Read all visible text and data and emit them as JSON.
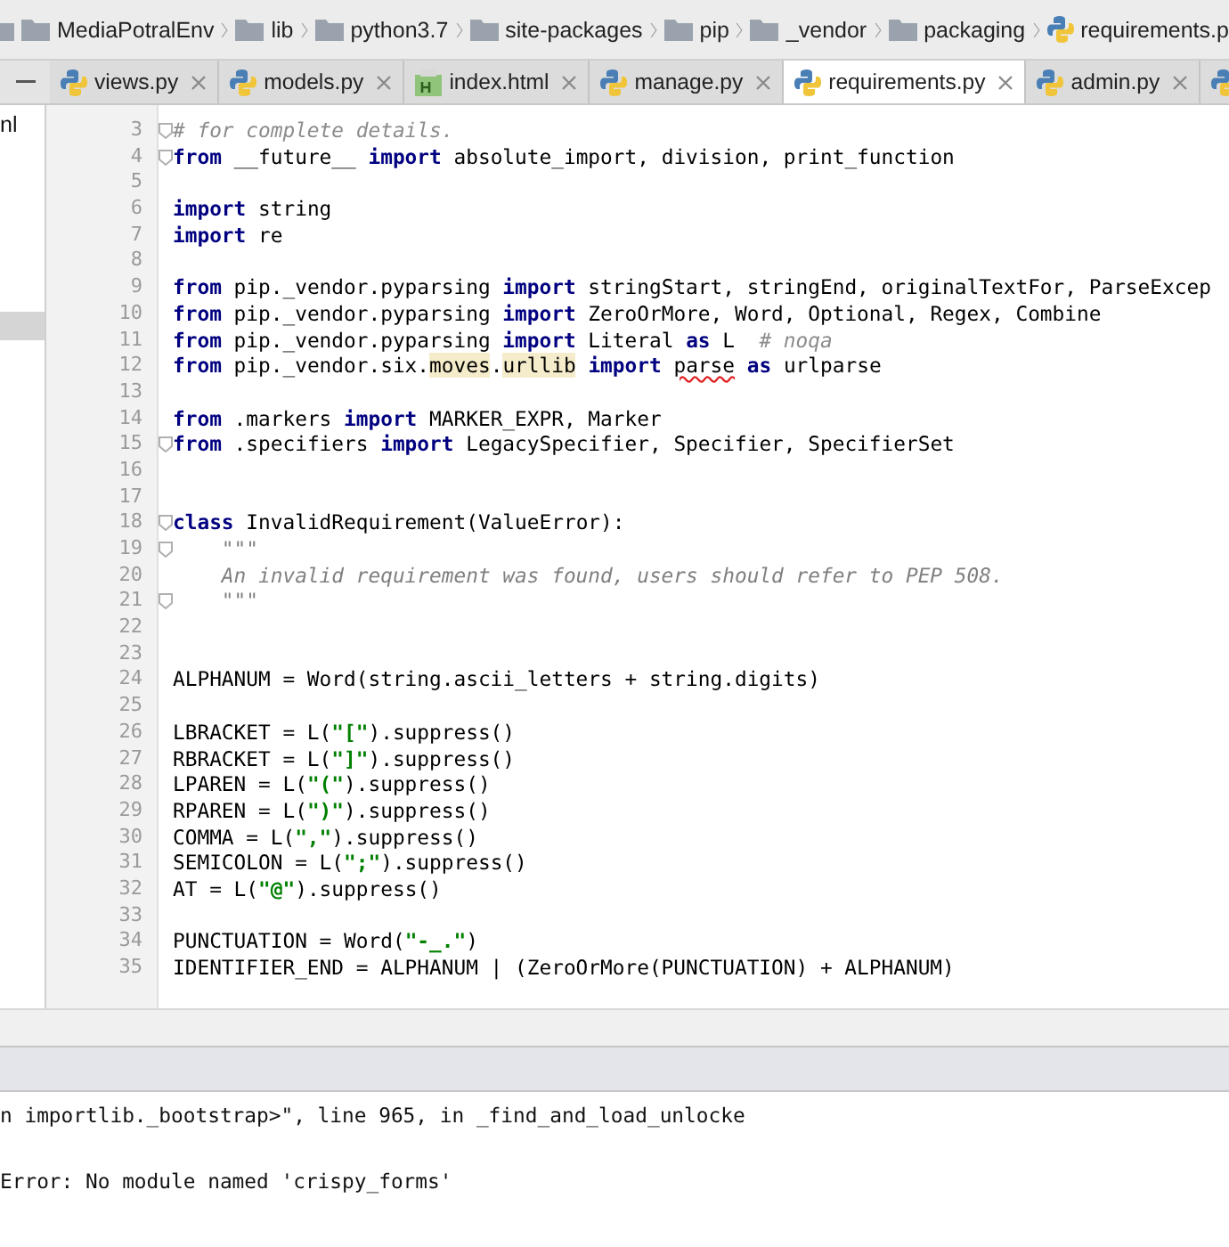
{
  "breadcrumbs": [
    {
      "label": "MediaPotralEnv",
      "kind": "folder"
    },
    {
      "label": "lib",
      "kind": "folder"
    },
    {
      "label": "python3.7",
      "kind": "folder"
    },
    {
      "label": "site-packages",
      "kind": "folder"
    },
    {
      "label": "pip",
      "kind": "folder"
    },
    {
      "label": "_vendor",
      "kind": "folder"
    },
    {
      "label": "packaging",
      "kind": "folder"
    },
    {
      "label": "requirements.p",
      "kind": "python"
    }
  ],
  "sidebar": {
    "items": [
      {
        "label": "nl",
        "selected": false
      }
    ]
  },
  "tabs": [
    {
      "label": "views.py",
      "kind": "python",
      "selected": false
    },
    {
      "label": "models.py",
      "kind": "python",
      "selected": false
    },
    {
      "label": "index.html",
      "kind": "html",
      "selected": false
    },
    {
      "label": "manage.py",
      "kind": "python",
      "selected": false
    },
    {
      "label": "requirements.py",
      "kind": "python",
      "selected": true
    },
    {
      "label": "admin.py",
      "kind": "python",
      "selected": false
    }
  ],
  "editor": {
    "lines": [
      {
        "number": "3",
        "fold": true,
        "tokens": [
          {
            "kind": "comment",
            "text": "# for complete details."
          }
        ]
      },
      {
        "number": "4",
        "fold": true,
        "tokens": [
          {
            "kind": "keyword",
            "text": "from"
          },
          {
            "kind": "plain",
            "text": " __future__ "
          },
          {
            "kind": "keyword",
            "text": "import"
          },
          {
            "kind": "plain",
            "text": " absolute_import, division, print_function"
          }
        ]
      },
      {
        "number": "5",
        "fold": false
      },
      {
        "number": "6",
        "fold": false,
        "tokens": [
          {
            "kind": "keyword",
            "text": "import"
          },
          {
            "kind": "plain",
            "text": " string"
          }
        ]
      },
      {
        "number": "7",
        "fold": false,
        "tokens": [
          {
            "kind": "keyword",
            "text": "import"
          },
          {
            "kind": "plain",
            "text": " re"
          }
        ]
      },
      {
        "number": "8",
        "fold": false
      },
      {
        "number": "9",
        "fold": false,
        "tokens": [
          {
            "kind": "keyword",
            "text": "from"
          },
          {
            "kind": "plain",
            "text": " pip._vendor.pyparsing "
          },
          {
            "kind": "keyword",
            "text": "import"
          },
          {
            "kind": "plain",
            "text": " stringStart, stringEnd, originalTextFor, ParseExcep"
          }
        ]
      },
      {
        "number": "10",
        "fold": false,
        "tokens": [
          {
            "kind": "keyword",
            "text": "from"
          },
          {
            "kind": "plain",
            "text": " pip._vendor.pyparsing "
          },
          {
            "kind": "keyword",
            "text": "import"
          },
          {
            "kind": "plain",
            "text": " ZeroOrMore, Word, Optional, Regex, Combine"
          }
        ]
      },
      {
        "number": "11",
        "fold": false,
        "tokens": [
          {
            "kind": "keyword",
            "text": "from"
          },
          {
            "kind": "plain",
            "text": " pip._vendor.pyparsing "
          },
          {
            "kind": "keyword",
            "text": "import"
          },
          {
            "kind": "plain",
            "text": " Literal "
          },
          {
            "kind": "keyword",
            "text": "as"
          },
          {
            "kind": "plain",
            "text": " L  "
          },
          {
            "kind": "comment",
            "text": "# noqa"
          }
        ]
      },
      {
        "number": "12",
        "fold": false,
        "tokens": [
          {
            "kind": "keyword",
            "text": "from"
          },
          {
            "kind": "plain",
            "text": " pip._vendor.six."
          },
          {
            "kind": "highlight",
            "text": "moves"
          },
          {
            "kind": "plain",
            "text": "."
          },
          {
            "kind": "highlight",
            "text": "urllib"
          },
          {
            "kind": "keyword",
            "text": " import "
          },
          {
            "kind": "typo",
            "text": "parse"
          },
          {
            "kind": "keyword",
            "text": " as"
          },
          {
            "kind": "plain",
            "text": " urlparse"
          }
        ]
      },
      {
        "number": "13",
        "fold": false
      },
      {
        "number": "14",
        "fold": false,
        "tokens": [
          {
            "kind": "keyword",
            "text": "from"
          },
          {
            "kind": "plain",
            "text": " .markers "
          },
          {
            "kind": "keyword",
            "text": "import"
          },
          {
            "kind": "plain",
            "text": " MARKER_EXPR, Marker"
          }
        ]
      },
      {
        "number": "15",
        "fold": true,
        "tokens": [
          {
            "kind": "keyword",
            "text": "from"
          },
          {
            "kind": "plain",
            "text": " .specifiers "
          },
          {
            "kind": "keyword",
            "text": "import"
          },
          {
            "kind": "plain",
            "text": " LegacySpecifier, Specifier, SpecifierSet"
          }
        ]
      },
      {
        "number": "16",
        "fold": false
      },
      {
        "number": "17",
        "fold": false
      },
      {
        "number": "18",
        "fold": true,
        "tokens": [
          {
            "kind": "keyword",
            "text": "class"
          },
          {
            "kind": "plain",
            "text": " InvalidRequirement(ValueError):"
          }
        ]
      },
      {
        "number": "19",
        "fold": true,
        "tokens": [
          {
            "kind": "docstring",
            "text": "    \"\"\""
          }
        ]
      },
      {
        "number": "20",
        "fold": false,
        "tokens": [
          {
            "kind": "docstring",
            "text": "    An invalid requirement was found, users should refer to PEP 508."
          }
        ]
      },
      {
        "number": "21",
        "fold": true,
        "tokens": [
          {
            "kind": "docstring",
            "text": "    \"\"\""
          }
        ]
      },
      {
        "number": "22",
        "fold": false
      },
      {
        "number": "23",
        "fold": false
      },
      {
        "number": "24",
        "fold": false,
        "tokens": [
          {
            "kind": "plain",
            "text": "ALPHANUM = Word(string.ascii_letters + string.digits)"
          }
        ]
      },
      {
        "number": "25",
        "fold": false
      },
      {
        "number": "26",
        "fold": false,
        "tokens": [
          {
            "kind": "plain",
            "text": "LBRACKET = L("
          },
          {
            "kind": "string",
            "text": "\"[\""
          },
          {
            "kind": "plain",
            "text": ").suppress()"
          }
        ]
      },
      {
        "number": "27",
        "fold": false,
        "tokens": [
          {
            "kind": "plain",
            "text": "RBRACKET = L("
          },
          {
            "kind": "string",
            "text": "\"]\""
          },
          {
            "kind": "plain",
            "text": ").suppress()"
          }
        ]
      },
      {
        "number": "28",
        "fold": false,
        "tokens": [
          {
            "kind": "plain",
            "text": "LPAREN = L("
          },
          {
            "kind": "string",
            "text": "\"(\""
          },
          {
            "kind": "plain",
            "text": ").suppress()"
          }
        ]
      },
      {
        "number": "29",
        "fold": false,
        "tokens": [
          {
            "kind": "plain",
            "text": "RPAREN = L("
          },
          {
            "kind": "string",
            "text": "\")\""
          },
          {
            "kind": "plain",
            "text": ").suppress()"
          }
        ]
      },
      {
        "number": "30",
        "fold": false,
        "tokens": [
          {
            "kind": "plain",
            "text": "COMMA = L("
          },
          {
            "kind": "string",
            "text": "\",\""
          },
          {
            "kind": "plain",
            "text": ").suppress()"
          }
        ]
      },
      {
        "number": "31",
        "fold": false,
        "tokens": [
          {
            "kind": "plain",
            "text": "SEMICOLON = L("
          },
          {
            "kind": "string",
            "text": "\";\""
          },
          {
            "kind": "plain",
            "text": ").suppress()"
          }
        ]
      },
      {
        "number": "32",
        "fold": false,
        "tokens": [
          {
            "kind": "plain",
            "text": "AT = L("
          },
          {
            "kind": "string",
            "text": "\"@\""
          },
          {
            "kind": "plain",
            "text": ").suppress()"
          }
        ]
      },
      {
        "number": "33",
        "fold": false
      },
      {
        "number": "34",
        "fold": false,
        "tokens": [
          {
            "kind": "plain",
            "text": "PUNCTUATION = Word("
          },
          {
            "kind": "string",
            "text": "\"-_.\""
          },
          {
            "kind": "plain",
            "text": ")"
          }
        ]
      },
      {
        "number": "35",
        "fold": false,
        "tokens": [
          {
            "kind": "plain",
            "text": "IDENTIFIER_END = ALPHANUM | (ZeroOrMore(PUNCTUATION) + ALPHANUM)"
          }
        ]
      }
    ]
  },
  "console": {
    "lines": [
      "n importlib._bootstrap>\", line 965, in _find_and_load_unlocke",
      "Error: No module named 'crispy_forms'"
    ]
  }
}
